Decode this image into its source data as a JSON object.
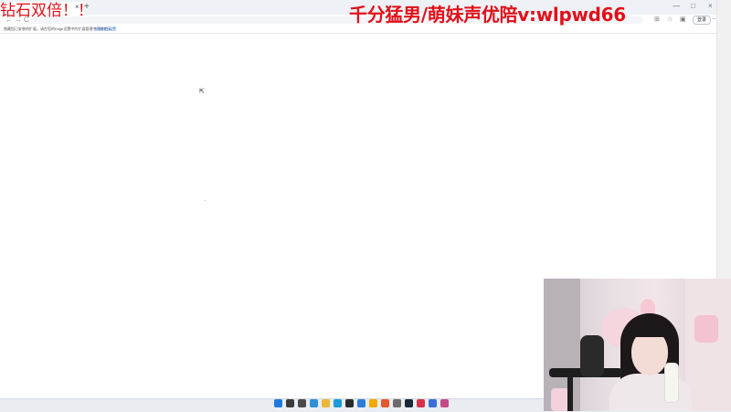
{
  "browser": {
    "tab_close_glyph": "×",
    "new_tab_glyph": "+",
    "window_controls": [
      "—",
      "□",
      "×"
    ],
    "nav_icons": [
      "←",
      "→",
      "C"
    ],
    "login_label": "登录",
    "infobar_text": "隐藏您已安装的扩展，请在您的Edge设置中的扩展管理中开启显示。",
    "infobar_link": "立即前往设置"
  },
  "overlays": {
    "left_text": "钻石双倍！！",
    "right_text": "千分猛男/萌妹声优陪v:wlpwd66"
  },
  "taskbar": {
    "apps": [
      {
        "name": "windows-start-icon",
        "color": "#1f7ae0"
      },
      {
        "name": "search-icon",
        "color": "#3b3b3b"
      },
      {
        "name": "task-view-icon",
        "color": "#4a4a4a"
      },
      {
        "name": "widgets-icon",
        "color": "#2f8fd8"
      },
      {
        "name": "file-explorer-icon",
        "color": "#e9b73a"
      },
      {
        "name": "edge-icon",
        "color": "#1e9bd7"
      },
      {
        "name": "terminal-icon",
        "color": "#2b2b2b"
      },
      {
        "name": "store-icon",
        "color": "#2e7cd6"
      },
      {
        "name": "notes-icon",
        "color": "#f2a900"
      },
      {
        "name": "game-icon",
        "color": "#e25a2c"
      },
      {
        "name": "settings-icon",
        "color": "#6b6b6b"
      },
      {
        "name": "steam-icon",
        "color": "#1b2838"
      },
      {
        "name": "music-icon",
        "color": "#d6334b"
      },
      {
        "name": "chat-icon",
        "color": "#3a6fd8"
      },
      {
        "name": "media-icon",
        "color": "#c14c8a"
      }
    ]
  },
  "colors": {
    "overlay_red": "#e0101a",
    "link_blue": "#1a66d2"
  }
}
